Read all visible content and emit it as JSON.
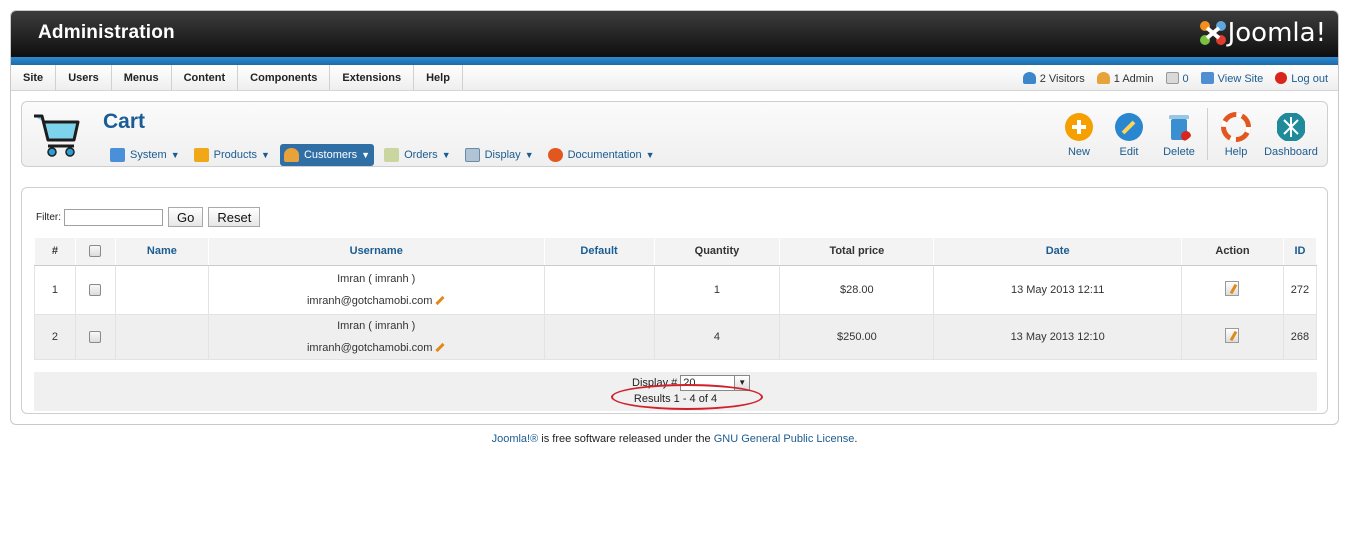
{
  "header": {
    "title": "Administration",
    "logo_text": "Joomla!"
  },
  "menu": [
    "Site",
    "Users",
    "Menus",
    "Content",
    "Components",
    "Extensions",
    "Help"
  ],
  "status": {
    "visitors": "2 Visitors",
    "admins": "1 Admin",
    "messages": "0",
    "view_site": "View Site",
    "logout": "Log out"
  },
  "toolbar": {
    "page_title": "Cart",
    "submenu": [
      {
        "label": "System",
        "icon": "tools-icon",
        "active": false
      },
      {
        "label": "Products",
        "icon": "box-icon",
        "active": false
      },
      {
        "label": "Customers",
        "icon": "users-icon",
        "active": true
      },
      {
        "label": "Orders",
        "icon": "orders-icon",
        "active": false
      },
      {
        "label": "Display",
        "icon": "display-icon",
        "active": false
      },
      {
        "label": "Documentation",
        "icon": "lifebuoy-icon",
        "active": false
      }
    ],
    "buttons": [
      {
        "label": "New",
        "icon": "plus-icon",
        "color": "#f5a000"
      },
      {
        "label": "Edit",
        "icon": "pencil-icon",
        "color": "#2a86cf"
      },
      {
        "label": "Delete",
        "icon": "trash-icon",
        "color": "#3a8fd0"
      },
      {
        "label": "Help",
        "icon": "lifebuoy-icon",
        "color": "#e2571f"
      },
      {
        "label": "Dashboard",
        "icon": "dashboard-icon",
        "color": "#1e8a9a"
      }
    ]
  },
  "filter": {
    "label": "Filter:",
    "value": "",
    "go": "Go",
    "reset": "Reset"
  },
  "table": {
    "headers": [
      "#",
      "",
      "Name",
      "Username",
      "Default",
      "Quantity",
      "Total price",
      "Date",
      "Action",
      "ID"
    ],
    "rows": [
      {
        "num": "1",
        "name": "",
        "username": "Imran ( imranh )",
        "email": "imranh@gotchamobi.com",
        "default": "",
        "quantity": "1",
        "total": "$28.00",
        "date": "13 May 2013 12:11",
        "id": "272"
      },
      {
        "num": "2",
        "name": "",
        "username": "Imran ( imranh )",
        "email": "imranh@gotchamobi.com",
        "default": "",
        "quantity": "4",
        "total": "$250.00",
        "date": "13 May 2013 12:10",
        "id": "268"
      }
    ]
  },
  "pagination": {
    "display_label": "Display #",
    "display_value": "20",
    "results": "Results 1 - 4 of 4"
  },
  "footer": {
    "joomla_link": "Joomla!®",
    "text": " is free software released under the ",
    "license_link": "GNU General Public License",
    "end": "."
  }
}
